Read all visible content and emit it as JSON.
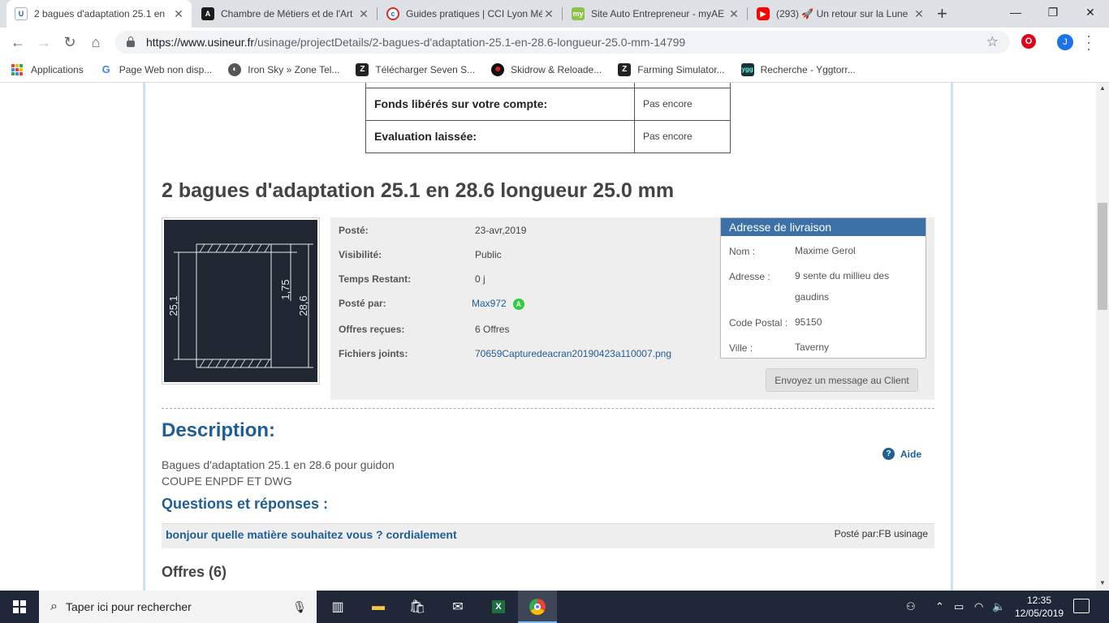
{
  "browser": {
    "tabs": [
      {
        "title": "2 bagues d'adaptation 25.1 en",
        "active": true,
        "icon": "usineur-favicon"
      },
      {
        "title": "Chambre de Métiers et de l'Art",
        "active": false,
        "icon": "cma-favicon"
      },
      {
        "title": "Guides pratiques | CCI Lyon Mé",
        "active": false,
        "icon": "cci-favicon"
      },
      {
        "title": "Site Auto Entrepreneur - myAE",
        "active": false,
        "icon": "myae-favicon"
      },
      {
        "title": "(293) 🚀 Un retour sur la Lune",
        "active": false,
        "icon": "youtube-favicon"
      }
    ],
    "new_tab": "+",
    "url_host": "https://www.usineur.fr",
    "url_path": "/usinage/projectDetails/2-bagues-d'adaptation-25.1-en-28.6-longueur-25.0-mm-14799",
    "profile_initial": "J",
    "bookmarks": [
      {
        "label": "Applications",
        "icon": "apps-grid-icon"
      },
      {
        "label": "Page Web non disp...",
        "icon": "google-icon"
      },
      {
        "label": "Iron Sky » Zone Tel...",
        "icon": "globe-icon"
      },
      {
        "label": "Télécharger Seven S...",
        "icon": "zt-icon"
      },
      {
        "label": "Skidrow & Reloade...",
        "icon": "skull-icon"
      },
      {
        "label": "Farming Simulator...",
        "icon": "zt-icon"
      },
      {
        "label": "Recherche - Yggtorr...",
        "icon": "ygg-icon"
      }
    ]
  },
  "page": {
    "status_rows": [
      {
        "label": "Fonds libérés sur votre compte:",
        "value": "Pas encore"
      },
      {
        "label": "Evaluation laissée:",
        "value": "Pas encore"
      }
    ],
    "title": "2 bagues d'adaptation 25.1 en 28.6 longueur 25.0 mm",
    "drawing": {
      "dim1": "25,1",
      "dim2": "1,75",
      "dim3": "28,6"
    },
    "info": [
      {
        "label": "Posté:",
        "value": "23-avr,2019"
      },
      {
        "label": "Visibilité:",
        "value": "Public"
      },
      {
        "label": "Temps Restant:",
        "value": "0 j"
      },
      {
        "label": "Posté par:",
        "value": "Max972",
        "badge": "A"
      },
      {
        "label": "Offres reçues:",
        "value": "6 Offres"
      },
      {
        "label": "Fichiers joints:",
        "value": "70659Capturedeacran20190423a110007.png"
      }
    ],
    "address": {
      "header": "Adresse de livraison",
      "rows": [
        {
          "label": "Nom :",
          "value": "Maxime Gerol"
        },
        {
          "label": "Adresse :",
          "value": "9 sente du millieu des gaudins"
        },
        {
          "label": "Code Postal :",
          "value": "95150"
        },
        {
          "label": "Ville :",
          "value": "Taverny"
        }
      ]
    },
    "message_button": "Envoyez un message au Client",
    "description_heading": "Description:",
    "help_label": "Aide",
    "description_lines": [
      "Bagues d'adaptation 25.1 en 28.6 pour guidon",
      "COUPE ENPDF ET DWG"
    ],
    "qa_heading": "Questions et réponses :",
    "qa": {
      "question": "bonjour quelle matière souhaitez vous ? cordialement",
      "posted_by": "Posté par:FB usinage"
    },
    "offers_heading": "Offres (6)"
  },
  "taskbar": {
    "search_placeholder": "Taper ici pour rechercher",
    "time": "12:35",
    "date": "12/05/2019"
  }
}
